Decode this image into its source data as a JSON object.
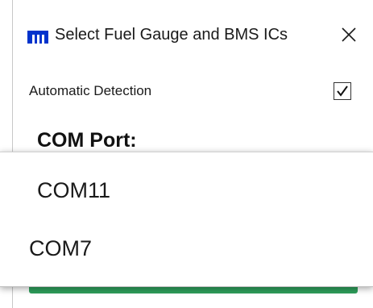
{
  "dialog": {
    "title": "Select Fuel Gauge and BMS ICs",
    "logo_icon": "maxim-m-logo",
    "close_icon": "close-x",
    "logo_color": "#0033cc"
  },
  "detection": {
    "label": "Automatic Detection",
    "checked": true
  },
  "com_port": {
    "label": "COM Port:"
  },
  "dropdown": {
    "options": [
      "COM11",
      "COM7"
    ]
  },
  "colors": {
    "button_green": "#2e9e5b"
  }
}
